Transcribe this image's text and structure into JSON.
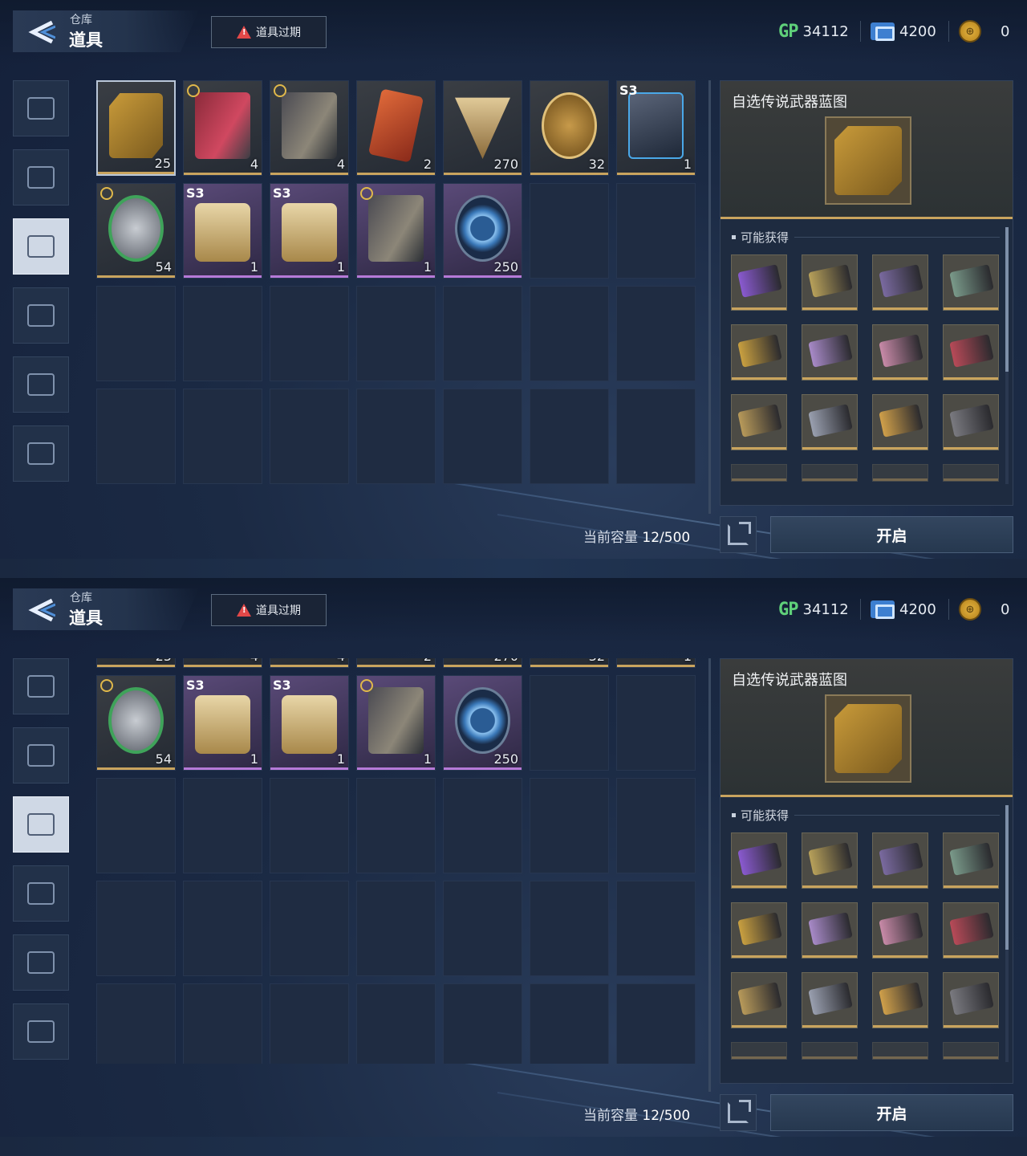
{
  "header": {
    "back_label_small": "仓库",
    "back_label_big": "道具",
    "expired_button": "道具过期"
  },
  "currencies": {
    "gp_icon": "GP",
    "gp": "34112",
    "ticket_icon": "ticket-icon",
    "ticket": "4200",
    "gold_icon": "gold-coin-icon",
    "gold": "0"
  },
  "sidebar": {
    "items": [
      {
        "name": "pistol-icon",
        "active": false
      },
      {
        "name": "frame-icon",
        "active": false
      },
      {
        "name": "canister-icon",
        "active": true
      },
      {
        "name": "gun-parts-icon",
        "active": false
      },
      {
        "name": "blueprint-compass-icon",
        "active": false
      },
      {
        "name": "star-badge-icon",
        "active": false
      }
    ]
  },
  "inventory": {
    "items": [
      {
        "label": "自选传说武器蓝图",
        "qty": "25",
        "art": "bp",
        "tag": "",
        "timed": false,
        "purple": false,
        "selected": true
      },
      {
        "label": "red-gun",
        "qty": "4",
        "art": "gun-red",
        "tag": "",
        "timed": true,
        "purple": false,
        "selected": false
      },
      {
        "label": "dark-gun",
        "qty": "4",
        "art": "gun-dark",
        "tag": "",
        "timed": true,
        "purple": false,
        "selected": false
      },
      {
        "label": "card",
        "qty": "2",
        "art": "card",
        "tag": "",
        "timed": false,
        "purple": false,
        "selected": false
      },
      {
        "label": "triangle-token",
        "qty": "270",
        "art": "tri",
        "tag": "",
        "timed": false,
        "purple": false,
        "selected": false
      },
      {
        "label": "cross-coin",
        "qty": "32",
        "art": "coin",
        "tag": "",
        "timed": false,
        "purple": false,
        "selected": false
      },
      {
        "label": "backpack",
        "qty": "1",
        "art": "pack",
        "tag": "S3",
        "timed": false,
        "purple": false,
        "selected": false
      },
      {
        "label": "horse-medal",
        "qty": "54",
        "art": "horse",
        "tag": "",
        "timed": true,
        "purple": false,
        "selected": false
      },
      {
        "label": "chest-1",
        "qty": "1",
        "art": "chest",
        "tag": "S3",
        "timed": false,
        "purple": true,
        "selected": false
      },
      {
        "label": "chest-2",
        "qty": "1",
        "art": "chest",
        "tag": "S3",
        "timed": false,
        "purple": true,
        "selected": false
      },
      {
        "label": "camo-rifle",
        "qty": "1",
        "art": "gun-dark",
        "tag": "",
        "timed": true,
        "purple": true,
        "selected": false
      },
      {
        "label": "blue-ring",
        "qty": "250",
        "art": "ring",
        "tag": "",
        "timed": false,
        "purple": true,
        "selected": false
      }
    ],
    "capacity_label": "当前容量",
    "capacity_value": "12/500"
  },
  "detail": {
    "title": "自选传说武器蓝图",
    "possible_label": "可能获得",
    "rewards": [
      {
        "color": "#8a5ad0"
      },
      {
        "color": "#b8a15a"
      },
      {
        "color": "#7a6aa0"
      },
      {
        "color": "#7a9a8a"
      },
      {
        "color": "#c9a040"
      },
      {
        "color": "#a88ac8"
      },
      {
        "color": "#c88aa8"
      },
      {
        "color": "#b84a58"
      },
      {
        "color": "#b89a5a"
      },
      {
        "color": "#9aa0b0"
      },
      {
        "color": "#d0a04a"
      },
      {
        "color": "#7a7a80"
      }
    ],
    "open_button": "开启",
    "share_icon": "share-icon"
  }
}
